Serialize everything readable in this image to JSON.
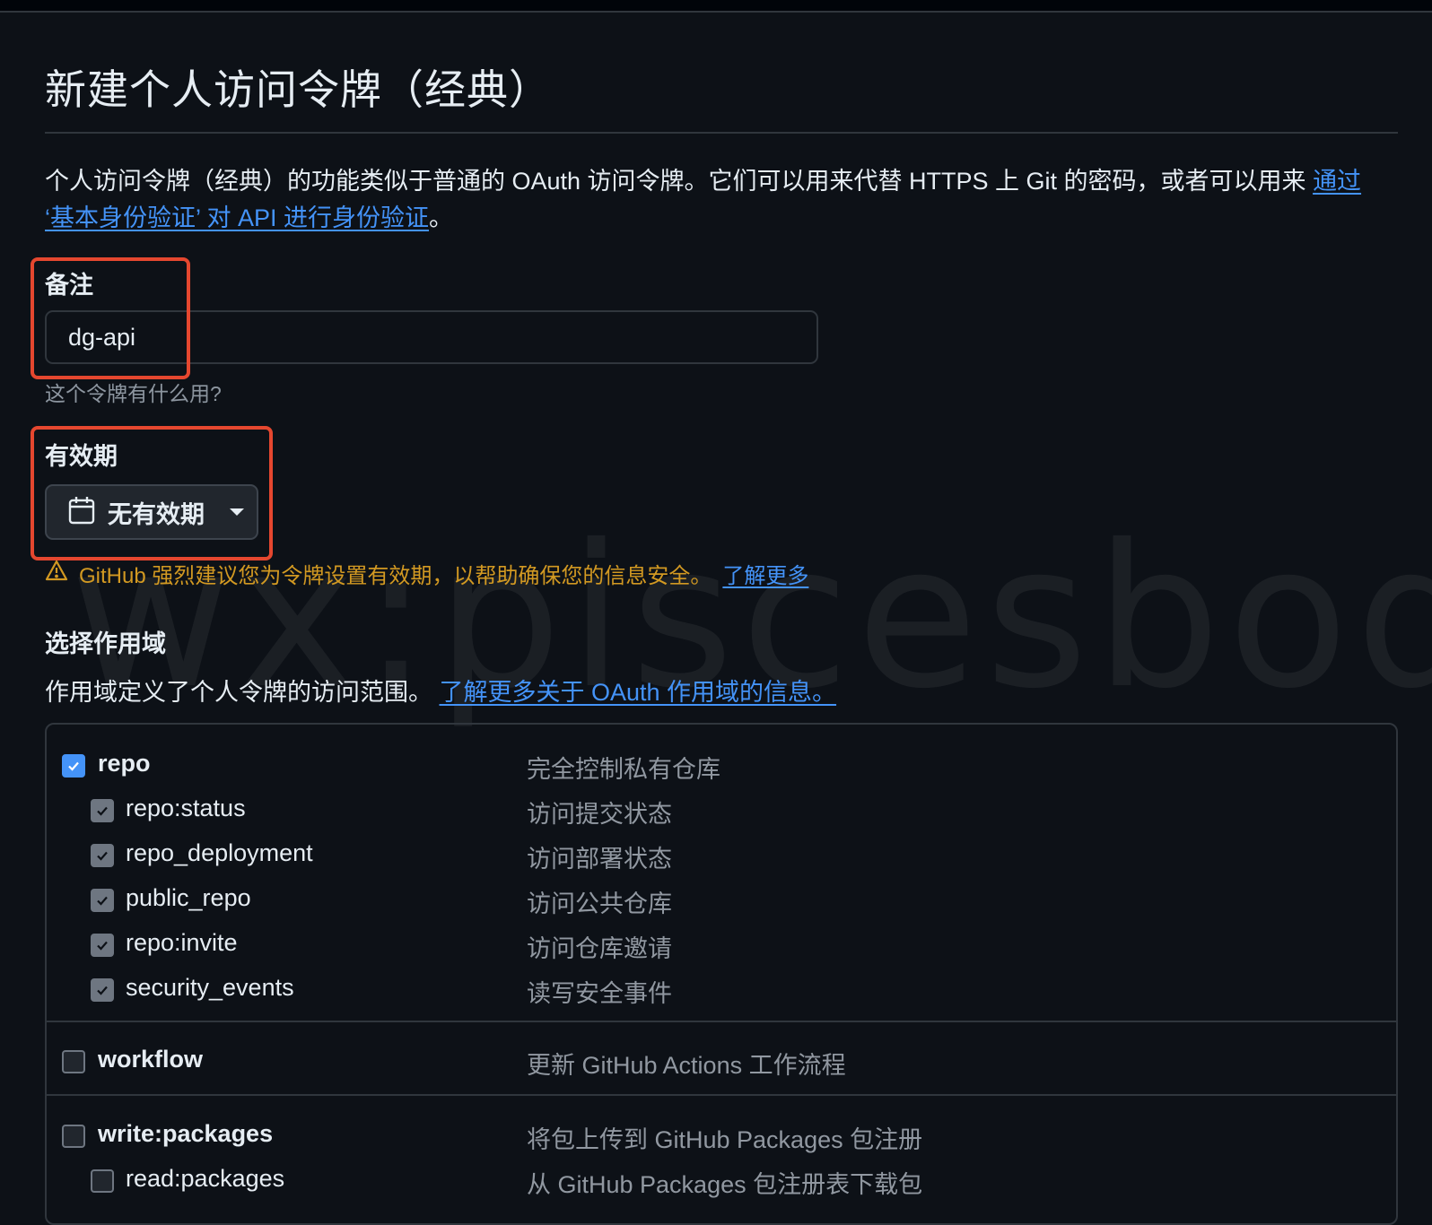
{
  "page": {
    "title": "新建个人访问令牌（经典）",
    "intro_text": "个人访问令牌（经典）的功能类似于普通的 OAuth 访问令牌。它们可以用来代替 HTTPS 上 Git 的密码，或者可以用来 ",
    "intro_link": "通过 ‘基本身份验证’ 对 API 进行身份验证",
    "intro_end": "。"
  },
  "note": {
    "label": "备注",
    "value": "dg-api",
    "hint": "这个令牌有什么用?"
  },
  "expiration": {
    "label": "有效期",
    "selected": "无有效期",
    "icon": "calendar-icon"
  },
  "warning": {
    "icon": "alert-icon",
    "text": "GitHub 强烈建议您为令牌设置有效期，以帮助确保您的信息安全。",
    "link": "了解更多"
  },
  "scopes_section": {
    "title": "选择作用域",
    "desc": "作用域定义了个人令牌的访问范围。",
    "link": "了解更多关于 OAuth 作用域的信息。"
  },
  "watermark": "wx:piscesbody",
  "scope_groups": [
    {
      "main": {
        "name": "repo",
        "desc": "完全控制私有仓库",
        "checked": true
      },
      "subs": [
        {
          "name": "repo:status",
          "desc": "访问提交状态",
          "checked": true
        },
        {
          "name": "repo_deployment",
          "desc": "访问部署状态",
          "checked": true
        },
        {
          "name": "public_repo",
          "desc": "访问公共仓库",
          "checked": true
        },
        {
          "name": "repo:invite",
          "desc": "访问仓库邀请",
          "checked": true
        },
        {
          "name": "security_events",
          "desc": "读写安全事件",
          "checked": true
        }
      ]
    },
    {
      "main": {
        "name": "workflow",
        "desc": "更新 GitHub Actions 工作流程",
        "checked": false
      },
      "subs": []
    },
    {
      "main": {
        "name": "write:packages",
        "desc": "将包上传到 GitHub Packages 包注册",
        "checked": false
      },
      "subs": [
        {
          "name": "read:packages",
          "desc": "从 GitHub Packages 包注册表下载包",
          "checked": false
        }
      ]
    }
  ],
  "colors": {
    "background": "#0d1117",
    "link": "#4493f8",
    "warning": "#d29922",
    "highlight_box": "#e5472f",
    "checkbox_checked": "#4493f8"
  }
}
